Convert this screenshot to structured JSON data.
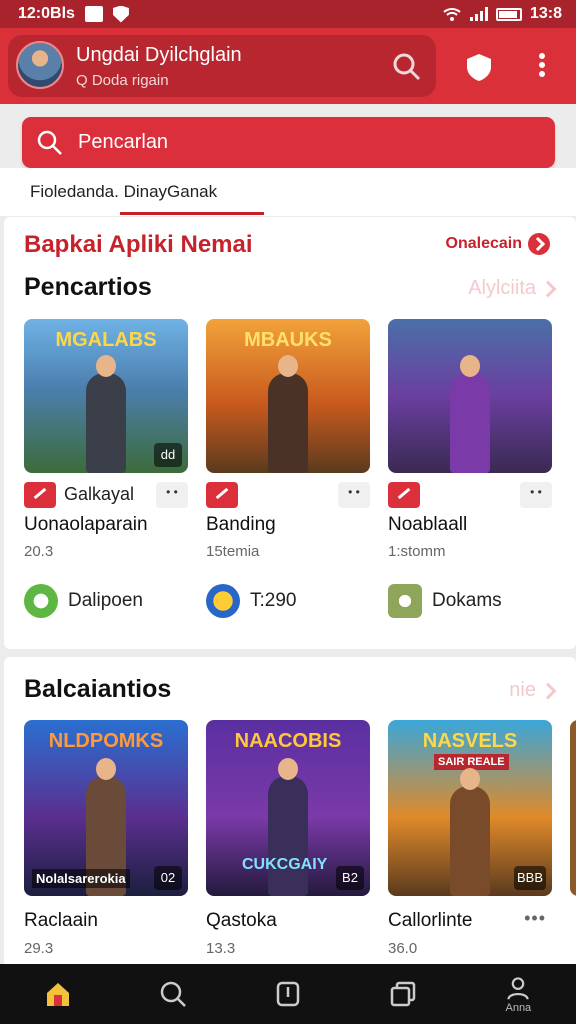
{
  "status": {
    "time": "12:0Bls",
    "battery": "13:8"
  },
  "appbar": {
    "title": "Ungdai Dyilchglain",
    "subtitle": "Q Doda rigain"
  },
  "search": {
    "placeholder": "Pencarlan"
  },
  "crumb": {
    "text": "Fioledanda. DinayGanak"
  },
  "section1": {
    "banner": "Bapkai Apliki Nemai",
    "banner_link": "Onalecain",
    "title": "Pencartios",
    "title_link": "Alylciita",
    "games": [
      {
        "thumb_title": "MGALABS",
        "corner": "dd",
        "category": "Galkayal",
        "name": "Uonaolaparain",
        "rating": "20.3",
        "developer": "Dalipoen"
      },
      {
        "thumb_title": "MBAUKS",
        "corner": "",
        "category": "",
        "name": "Banding",
        "rating": "15temia",
        "developer": "T:290"
      },
      {
        "thumb_title": "",
        "corner": "",
        "category": "",
        "name": "Noablaall",
        "rating": "1:stomm",
        "developer": "Dokams"
      }
    ]
  },
  "section2": {
    "title": "Balcaiantios",
    "title_link": "nie",
    "games": [
      {
        "thumb_title": "NLDPOMKS",
        "tag": "Nolalsarerokia",
        "corner": "02",
        "name": "Raclaain",
        "rating": "29.3"
      },
      {
        "thumb_title": "NAACOBIS",
        "tag": "CUKCGAIY",
        "corner": "B2",
        "name": "Qastoka",
        "rating": "13.3"
      },
      {
        "thumb_title": "NASVELS",
        "tag": "SAIR REALE",
        "corner": "BBB",
        "name": "Callorlinte",
        "rating": "36.0"
      }
    ]
  },
  "nav": {
    "profile_label": "Anna"
  },
  "colors": {
    "primary": "#d9303a",
    "primary_dark": "#a8232b",
    "accent_text": "#c4232c"
  }
}
